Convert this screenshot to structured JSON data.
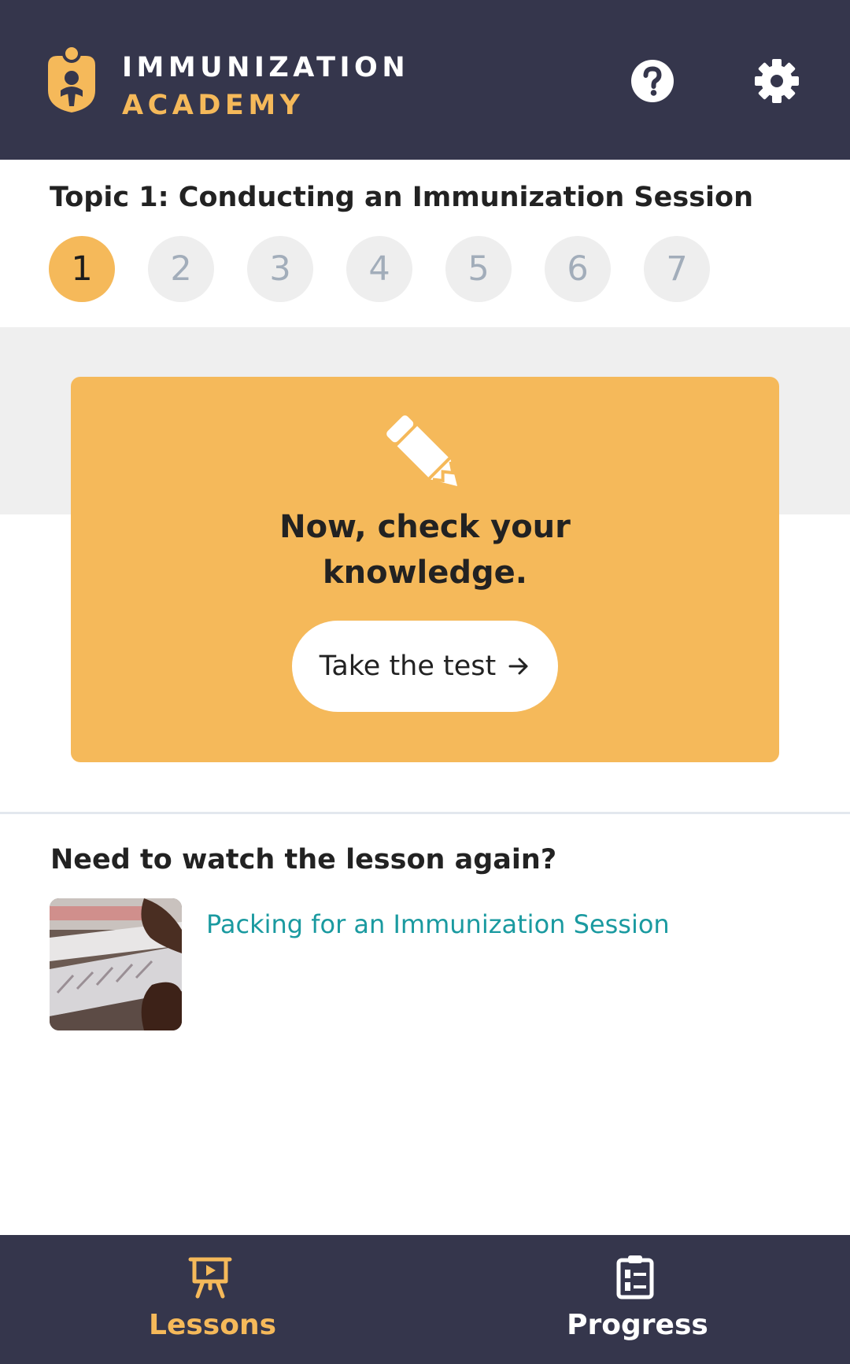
{
  "header": {
    "brand_line1": "IMMUNIZATION",
    "brand_line2": "ACADEMY",
    "logo_icon": "immunization-academy-logo-icon",
    "help_icon": "help-circle-icon",
    "settings_icon": "gear-icon"
  },
  "topic": {
    "title": "Topic 1: Conducting an Immunization Session",
    "steps": [
      "1",
      "2",
      "3",
      "4",
      "5",
      "6",
      "7"
    ],
    "active_step": "1"
  },
  "knowledge_card": {
    "icon": "pencil-icon",
    "heading_line1": "Now, check your",
    "heading_line2": "knowledge.",
    "button_label": "Take the test",
    "button_icon": "arrow-right-icon"
  },
  "rewatch": {
    "heading": "Need to watch the lesson again?",
    "lesson_title": "Packing for an Immunization Session"
  },
  "bottom_nav": {
    "items": [
      {
        "label": "Lessons",
        "icon": "presentation-icon",
        "active": true
      },
      {
        "label": "Progress",
        "icon": "clipboard-list-icon",
        "active": false
      }
    ]
  },
  "colors": {
    "header_bg": "#35364c",
    "accent": "#f5b95a",
    "link": "#1a9aa0",
    "step_inactive_bg": "#eeeeee",
    "step_inactive_text": "#a2adba"
  }
}
